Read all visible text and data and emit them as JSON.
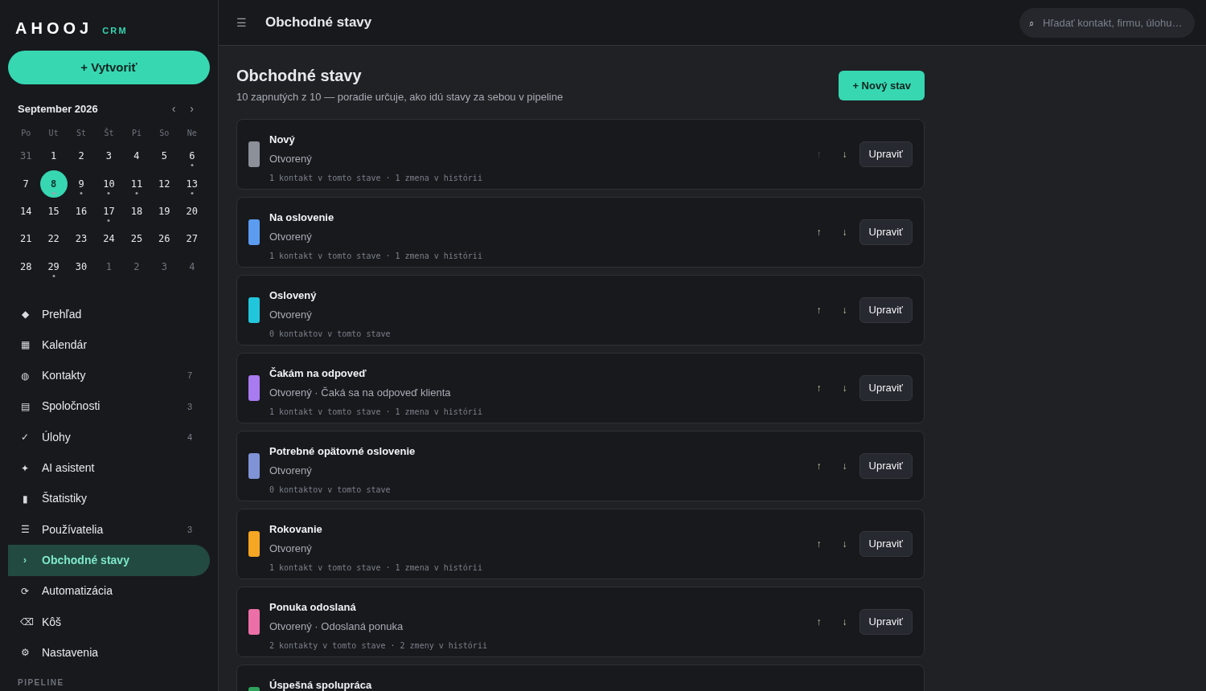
{
  "brand": {
    "name": "AHOOJ",
    "tag": "CRM"
  },
  "create_button": "+ Vytvoriť",
  "calendar": {
    "month": "September 2026",
    "prev": "‹",
    "next": "›",
    "weekdays": [
      "Po",
      "Ut",
      "St",
      "Št",
      "Pi",
      "So",
      "Ne"
    ],
    "days": [
      {
        "label": "31",
        "muted": true,
        "dot": false,
        "selected": false
      },
      {
        "label": "1",
        "muted": false,
        "dot": false,
        "selected": false
      },
      {
        "label": "2",
        "muted": false,
        "dot": false,
        "selected": false
      },
      {
        "label": "3",
        "muted": false,
        "dot": false,
        "selected": false
      },
      {
        "label": "4",
        "muted": false,
        "dot": false,
        "selected": false
      },
      {
        "label": "5",
        "muted": false,
        "dot": false,
        "selected": false
      },
      {
        "label": "6",
        "muted": false,
        "dot": true,
        "selected": false
      },
      {
        "label": "7",
        "muted": false,
        "dot": false,
        "selected": false
      },
      {
        "label": "8",
        "muted": false,
        "dot": true,
        "selected": true
      },
      {
        "label": "9",
        "muted": false,
        "dot": true,
        "selected": false
      },
      {
        "label": "10",
        "muted": false,
        "dot": true,
        "selected": false
      },
      {
        "label": "11",
        "muted": false,
        "dot": true,
        "selected": false
      },
      {
        "label": "12",
        "muted": false,
        "dot": false,
        "selected": false
      },
      {
        "label": "13",
        "muted": false,
        "dot": true,
        "selected": false
      },
      {
        "label": "14",
        "muted": false,
        "dot": false,
        "selected": false
      },
      {
        "label": "15",
        "muted": false,
        "dot": false,
        "selected": false
      },
      {
        "label": "16",
        "muted": false,
        "dot": false,
        "selected": false
      },
      {
        "label": "17",
        "muted": false,
        "dot": true,
        "selected": false
      },
      {
        "label": "18",
        "muted": false,
        "dot": false,
        "selected": false
      },
      {
        "label": "19",
        "muted": false,
        "dot": false,
        "selected": false
      },
      {
        "label": "20",
        "muted": false,
        "dot": false,
        "selected": false
      },
      {
        "label": "21",
        "muted": false,
        "dot": false,
        "selected": false
      },
      {
        "label": "22",
        "muted": false,
        "dot": false,
        "selected": false
      },
      {
        "label": "23",
        "muted": false,
        "dot": false,
        "selected": false
      },
      {
        "label": "24",
        "muted": false,
        "dot": false,
        "selected": false
      },
      {
        "label": "25",
        "muted": false,
        "dot": false,
        "selected": false
      },
      {
        "label": "26",
        "muted": false,
        "dot": false,
        "selected": false
      },
      {
        "label": "27",
        "muted": false,
        "dot": false,
        "selected": false
      },
      {
        "label": "28",
        "muted": false,
        "dot": false,
        "selected": false
      },
      {
        "label": "29",
        "muted": false,
        "dot": true,
        "selected": false
      },
      {
        "label": "30",
        "muted": false,
        "dot": false,
        "selected": false
      },
      {
        "label": "1",
        "muted": true,
        "dot": false,
        "selected": false
      },
      {
        "label": "2",
        "muted": true,
        "dot": false,
        "selected": false
      },
      {
        "label": "3",
        "muted": true,
        "dot": false,
        "selected": false
      },
      {
        "label": "4",
        "muted": true,
        "dot": false,
        "selected": false
      }
    ]
  },
  "nav": [
    {
      "icon": "◆",
      "label": "Prehľad",
      "selected": false
    },
    {
      "icon": "▦",
      "label": "Kalendár",
      "selected": false
    },
    {
      "icon": "◍",
      "label": "Kontakty",
      "count": "7",
      "selected": false
    },
    {
      "icon": "▤",
      "label": "Spoločnosti",
      "count": "3",
      "selected": false
    },
    {
      "icon": "✓",
      "label": "Úlohy",
      "count": "4",
      "selected": false
    },
    {
      "icon": "✦",
      "label": "AI asistent",
      "selected": false
    },
    {
      "icon": "▮",
      "label": "Štatistiky",
      "selected": false
    },
    {
      "icon": "☰",
      "label": "Používatelia",
      "count": "3",
      "selected": false
    },
    {
      "icon": "›",
      "label": "Obchodné stavy",
      "selected": true
    },
    {
      "icon": "⟳",
      "label": "Automatizácia",
      "selected": false
    },
    {
      "icon": "⌫",
      "label": "Kôš",
      "selected": false
    },
    {
      "icon": "⚙",
      "label": "Nastavenia",
      "selected": false
    }
  ],
  "sidebar_section": "PIPELINE",
  "topbar": {
    "menu_icon": "☰",
    "title": "Obchodné stavy",
    "search_icon": "⌕",
    "search_placeholder": "Hľadať kontakt, firmu, úlohu…"
  },
  "page": {
    "title": "Obchodné stavy",
    "subtitle": "10 zapnutých z 10 — poradie určuje, ako idú stavy za sebou v pipeline",
    "new_button": "+ Nový stav"
  },
  "stages": [
    {
      "name": "Nový",
      "status": "Otvorený",
      "stats": "1 kontakt v tomto stave · 1 zmena v histórii",
      "color": "#8b9099",
      "up_disabled": true,
      "up": "↑",
      "down": "↓",
      "edit": "Upraviť"
    },
    {
      "name": "Na oslovenie",
      "status": "Otvorený",
      "stats": "1 kontakt v tomto stave · 1 zmena v histórii",
      "color": "#5b9cf0",
      "up_disabled": false,
      "up": "↑",
      "down": "↓",
      "edit": "Upraviť"
    },
    {
      "name": "Oslovený",
      "status": "Otvorený",
      "stats": "0 kontaktov v tomto stave",
      "color": "#22c6dc",
      "up_disabled": false,
      "up": "↑",
      "down": "↓",
      "edit": "Upraviť"
    },
    {
      "name": "Čakám na odpoveď",
      "status": "Otvorený · Čaká sa na odpoveď klienta",
      "stats": "1 kontakt v tomto stave · 1 zmena v histórii",
      "color": "#a87bf0",
      "up_disabled": false,
      "up": "↑",
      "down": "↓",
      "edit": "Upraviť"
    },
    {
      "name": "Potrebné opätovné oslovenie",
      "status": "Otvorený",
      "stats": "0 kontaktov v tomto stave",
      "color": "#7f93d6",
      "up_disabled": false,
      "up": "↑",
      "down": "↓",
      "edit": "Upraviť"
    },
    {
      "name": "Rokovanie",
      "status": "Otvorený",
      "stats": "1 kontakt v tomto stave · 1 zmena v histórii",
      "color": "#f5a623",
      "up_disabled": false,
      "up": "↑",
      "down": "↓",
      "edit": "Upraviť"
    },
    {
      "name": "Ponuka odoslaná",
      "status": "Otvorený · Odoslaná ponuka",
      "stats": "2 kontakty v tomto stave · 2 zmeny v histórii",
      "color": "#ec6fa7",
      "up_disabled": false,
      "up": "↑",
      "down": "↓",
      "edit": "Upraviť"
    },
    {
      "name": "Úspešná spolupráca",
      "color": "#2fa35c"
    }
  ]
}
